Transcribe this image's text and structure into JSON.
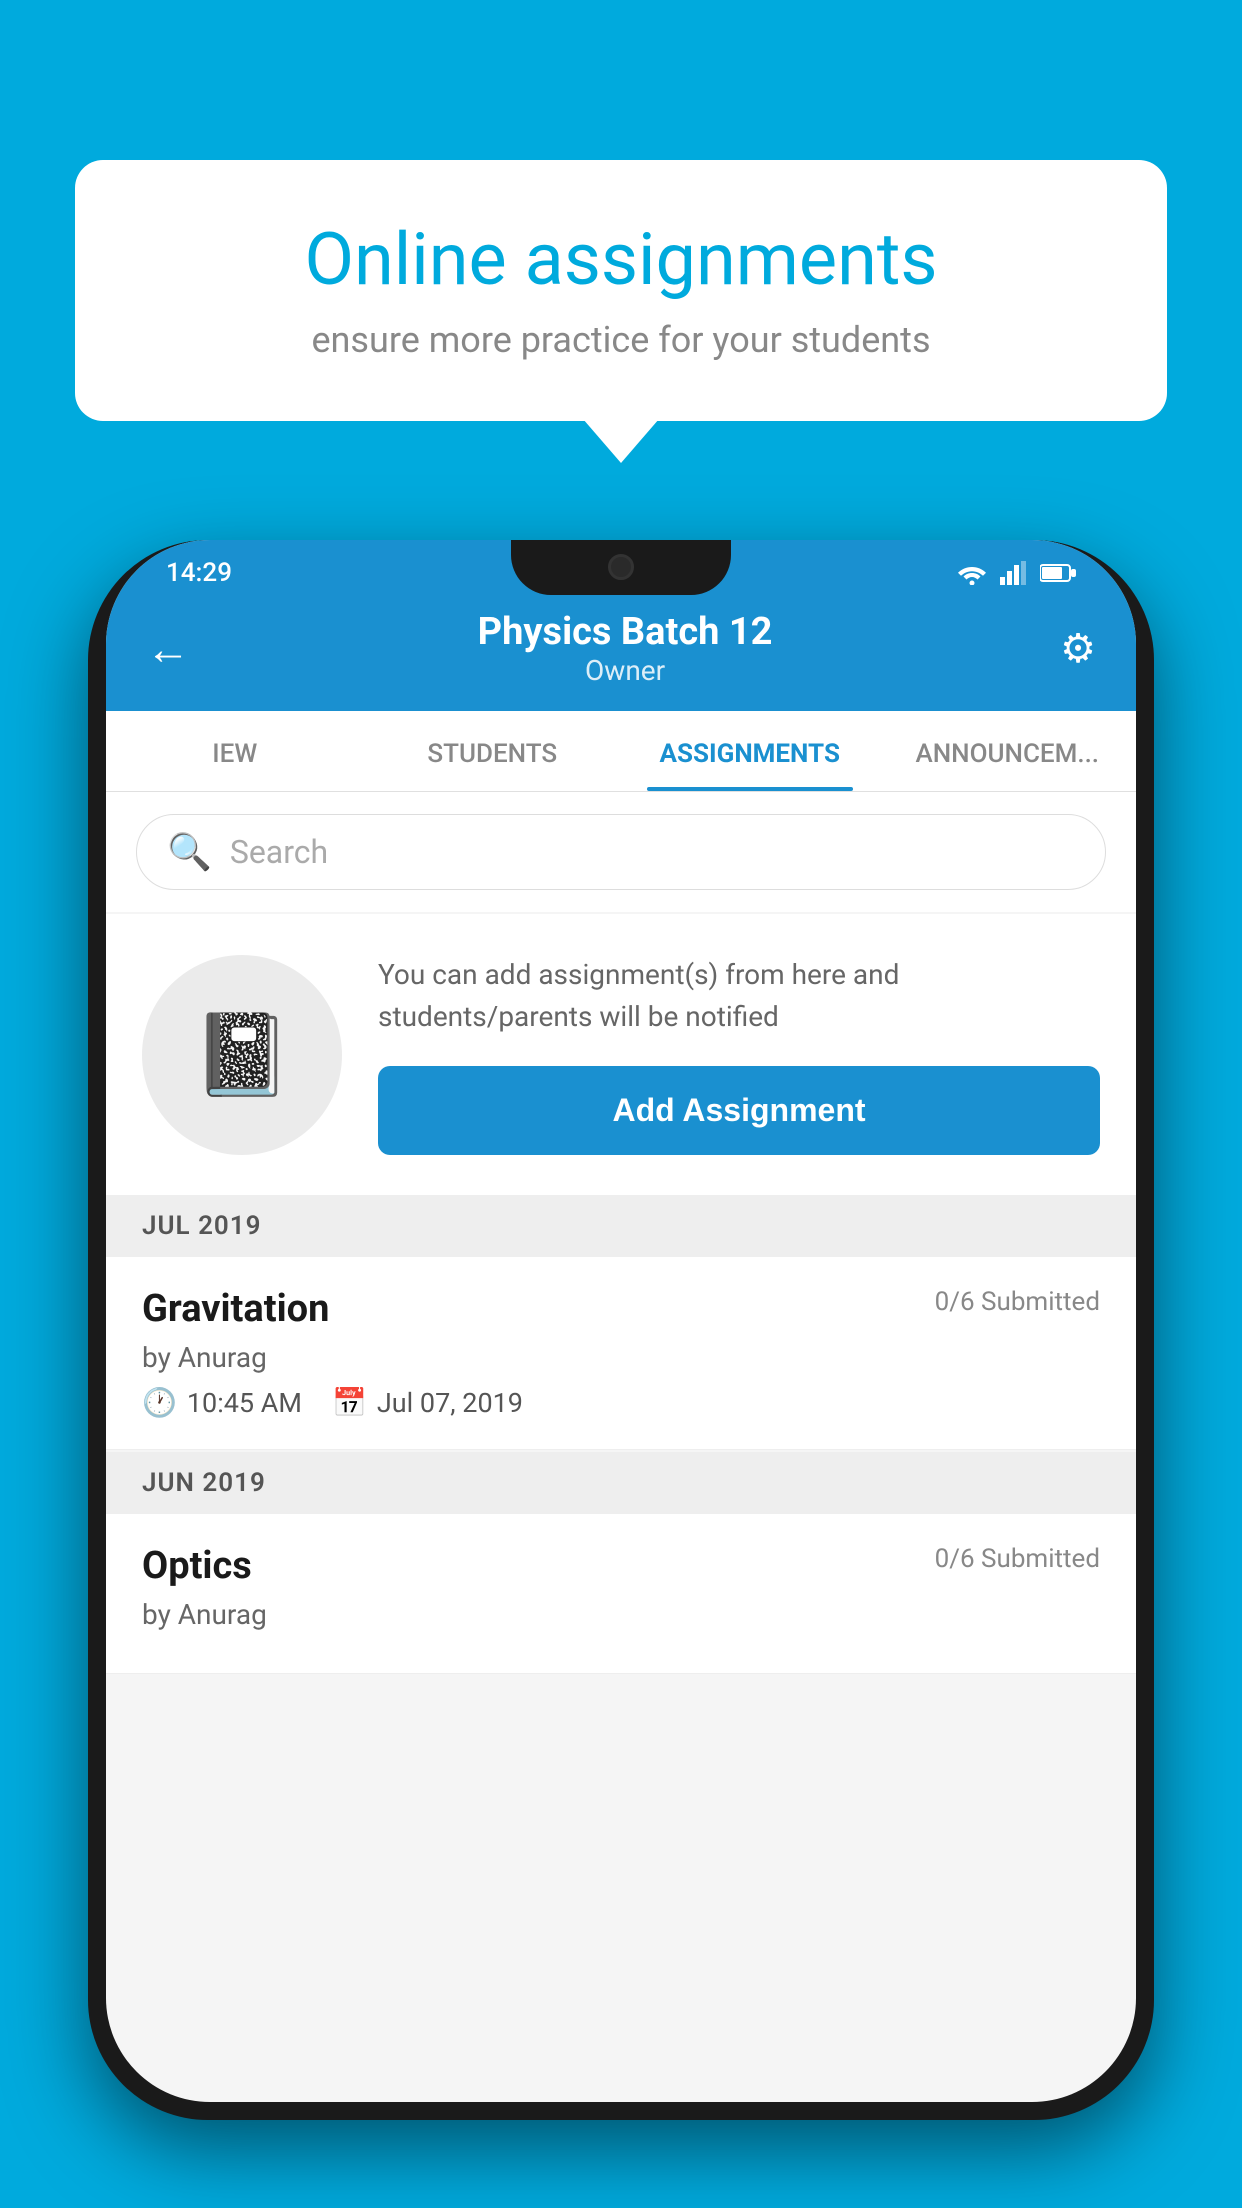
{
  "background": {
    "color": "#00AADD"
  },
  "speech_bubble": {
    "title": "Online assignments",
    "subtitle": "ensure more practice for your students"
  },
  "status_bar": {
    "time": "14:29",
    "icons": "wifi signal battery"
  },
  "app_header": {
    "title": "Physics Batch 12",
    "subtitle": "Owner",
    "back_icon": "←",
    "settings_icon": "⚙"
  },
  "tabs": [
    {
      "label": "IEW",
      "active": false
    },
    {
      "label": "STUDENTS",
      "active": false
    },
    {
      "label": "ASSIGNMENTS",
      "active": true
    },
    {
      "label": "ANNOUNCEM...",
      "active": false
    }
  ],
  "search": {
    "placeholder": "Search"
  },
  "add_assignment": {
    "description": "You can add assignment(s) from here and students/parents will be notified",
    "button_label": "Add Assignment"
  },
  "sections": [
    {
      "header": "JUL 2019",
      "assignments": [
        {
          "name": "Gravitation",
          "submitted": "0/6 Submitted",
          "by": "by Anurag",
          "time": "10:45 AM",
          "date": "Jul 07, 2019"
        }
      ]
    },
    {
      "header": "JUN 2019",
      "assignments": [
        {
          "name": "Optics",
          "submitted": "0/6 Submitted",
          "by": "by Anurag",
          "time": "",
          "date": ""
        }
      ]
    }
  ]
}
